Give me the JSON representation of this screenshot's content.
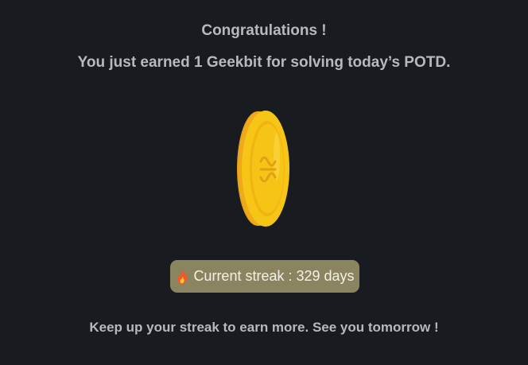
{
  "popup": {
    "title": "Congratulations !",
    "message": "You just earned 1 Geekbit for solving today’s POTD.",
    "streak_label": "Current streak : 329 days",
    "footer": "Keep up your streak to earn more. See you tomorrow !"
  },
  "icons": {
    "coin": "geekbit-coin-icon",
    "streak": "fire-icon"
  },
  "colors": {
    "background": "#181b1f",
    "text": "#b7b9bd",
    "badge_background": "#8a8560",
    "badge_text": "#f3f1e6",
    "coin_gold": "#f6c417",
    "coin_edge": "#e8a41a"
  }
}
